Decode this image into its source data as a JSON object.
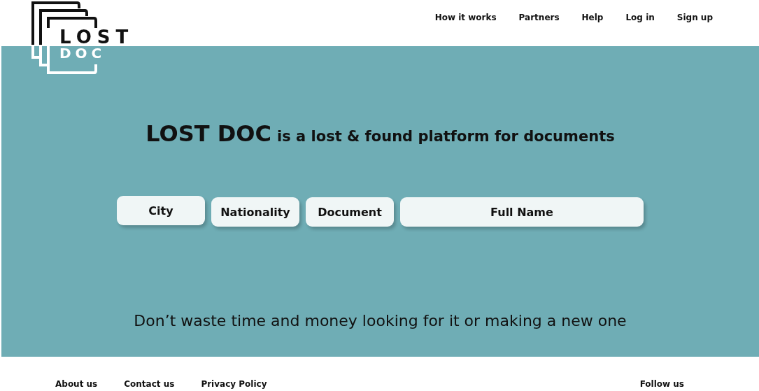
{
  "logo": {
    "line1": "LOST",
    "line2": "DOC"
  },
  "nav": [
    "How it works",
    "Partners",
    "Help",
    "Log in",
    "Sign up"
  ],
  "hero": {
    "brand": "LOST DOC",
    "tagline": "is a lost & found platform for documents",
    "fields": [
      {
        "placeholder": "City"
      },
      {
        "placeholder": "Nationality"
      },
      {
        "placeholder": "Document"
      },
      {
        "placeholder": "Full Name"
      }
    ],
    "subtitle": "Don’t waste time and money looking for it or making a new one"
  },
  "footer": {
    "links": [
      "About us",
      "Contact us",
      "Privacy Policy"
    ],
    "follow": "Follow us"
  }
}
